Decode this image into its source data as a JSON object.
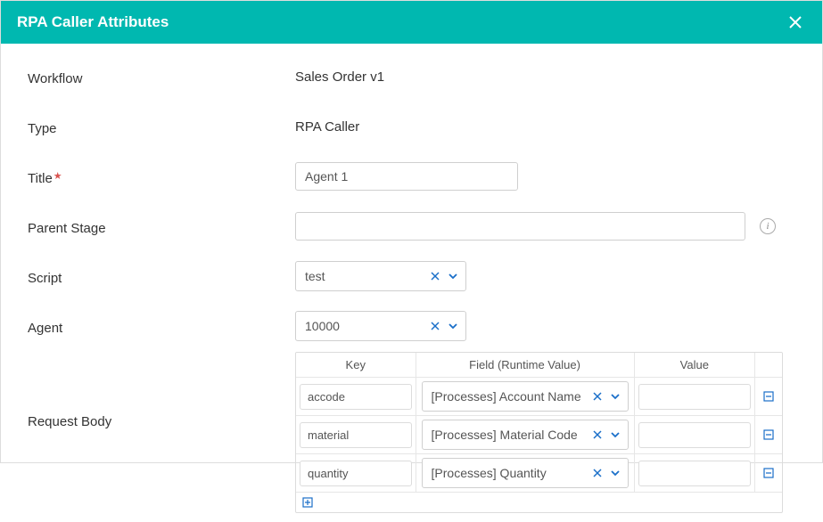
{
  "header": {
    "title": "RPA Caller Attributes"
  },
  "labels": {
    "workflow": "Workflow",
    "type": "Type",
    "title": "Title",
    "parentStage": "Parent Stage",
    "script": "Script",
    "agent": "Agent",
    "requestBody": "Request Body"
  },
  "values": {
    "workflow": "Sales Order v1",
    "type": "RPA Caller",
    "title": "Agent 1",
    "parentStage": "",
    "script": "test",
    "agent": "10000"
  },
  "table": {
    "headers": {
      "key": "Key",
      "field": "Field (Runtime Value)",
      "value": "Value"
    },
    "rows": [
      {
        "key": "accode",
        "field": "[Processes] Account Name",
        "value": ""
      },
      {
        "key": "material",
        "field": "[Processes] Material Code",
        "value": ""
      },
      {
        "key": "quantity",
        "field": "[Processes] Quantity",
        "value": ""
      }
    ]
  }
}
